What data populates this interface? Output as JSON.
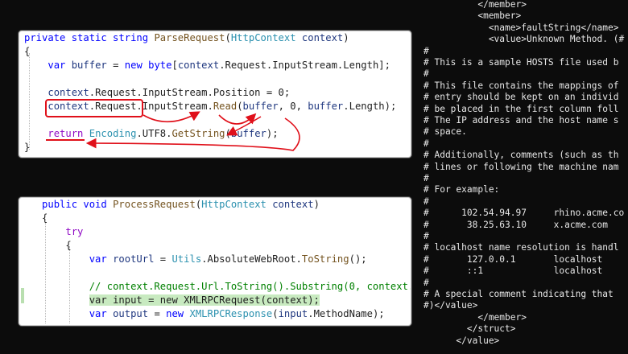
{
  "snippet_top": {
    "lines": [
      [
        {
          "c": "kw",
          "t": "private static string "
        },
        {
          "c": "mt",
          "t": "ParseRequest"
        },
        {
          "c": "",
          "t": "("
        },
        {
          "c": "ty",
          "t": "HttpContext"
        },
        {
          "c": "vr",
          "t": " context"
        },
        {
          "c": "",
          "t": ")"
        }
      ],
      [
        {
          "c": "",
          "t": "{"
        }
      ],
      [
        {
          "c": "",
          "t": "    "
        },
        {
          "c": "kw",
          "t": "var "
        },
        {
          "c": "vr",
          "t": "buffer"
        },
        {
          "c": "",
          "t": " = "
        },
        {
          "c": "kw",
          "t": "new byte"
        },
        {
          "c": "",
          "t": "["
        },
        {
          "c": "vr",
          "t": "context"
        },
        {
          "c": "",
          "t": ".Request.InputStream.Length];"
        }
      ],
      [
        {
          "c": "",
          "t": ""
        }
      ],
      [
        {
          "c": "",
          "t": "    "
        },
        {
          "c": "vr",
          "t": "context"
        },
        {
          "c": "",
          "t": ".Request.InputStream.Position = 0;"
        }
      ],
      [
        {
          "c": "",
          "t": "    "
        },
        {
          "c": "vr",
          "t": "context"
        },
        {
          "c": "",
          "t": ".Request.InputStream."
        },
        {
          "c": "mt",
          "t": "Read"
        },
        {
          "c": "",
          "t": "("
        },
        {
          "c": "vr",
          "t": "buffer"
        },
        {
          "c": "",
          "t": ", 0, "
        },
        {
          "c": "vr",
          "t": "buffer"
        },
        {
          "c": "",
          "t": ".Length);"
        }
      ],
      [
        {
          "c": "",
          "t": ""
        }
      ],
      [
        {
          "c": "",
          "t": "    "
        },
        {
          "c": "ctl",
          "t": "return "
        },
        {
          "c": "ty",
          "t": "Encoding"
        },
        {
          "c": "",
          "t": ".UTF8."
        },
        {
          "c": "mt",
          "t": "GetString"
        },
        {
          "c": "",
          "t": "("
        },
        {
          "c": "vr",
          "t": "buffer"
        },
        {
          "c": "",
          "t": ");"
        }
      ],
      [
        {
          "c": "",
          "t": "}"
        }
      ]
    ]
  },
  "snippet_bottom": {
    "lines": [
      [
        {
          "c": "",
          "t": "   "
        },
        {
          "c": "kw",
          "t": "public void "
        },
        {
          "c": "mt",
          "t": "ProcessRequest"
        },
        {
          "c": "",
          "t": "("
        },
        {
          "c": "ty",
          "t": "HttpContext"
        },
        {
          "c": "vr",
          "t": " context"
        },
        {
          "c": "",
          "t": ")"
        }
      ],
      [
        {
          "c": "",
          "t": "   {"
        }
      ],
      [
        {
          "c": "",
          "t": "       "
        },
        {
          "c": "ctl",
          "t": "try"
        }
      ],
      [
        {
          "c": "",
          "t": "       {"
        }
      ],
      [
        {
          "c": "",
          "t": "           "
        },
        {
          "c": "kw",
          "t": "var "
        },
        {
          "c": "vr",
          "t": "rootUrl"
        },
        {
          "c": "",
          "t": " = "
        },
        {
          "c": "ty",
          "t": "Utils"
        },
        {
          "c": "",
          "t": ".AbsoluteWebRoot."
        },
        {
          "c": "mt",
          "t": "ToString"
        },
        {
          "c": "",
          "t": "();"
        }
      ],
      [
        {
          "c": "",
          "t": ""
        }
      ],
      [
        {
          "c": "",
          "t": "           "
        },
        {
          "c": "cm",
          "t": "// context.Request.Url.ToString().Substring(0, context."
        }
      ],
      [
        {
          "c": "",
          "t": "           "
        },
        {
          "c": "hl",
          "t": "var input = new XMLRPCRequest(context);"
        }
      ],
      [
        {
          "c": "",
          "t": "           "
        },
        {
          "c": "kw",
          "t": "var "
        },
        {
          "c": "vr",
          "t": "output"
        },
        {
          "c": "",
          "t": " = "
        },
        {
          "c": "kw",
          "t": "new "
        },
        {
          "c": "ty",
          "t": "XMLRPCResponse"
        },
        {
          "c": "",
          "t": "("
        },
        {
          "c": "vr",
          "t": "input"
        },
        {
          "c": "",
          "t": ".MethodName);"
        }
      ]
    ]
  },
  "terminal": {
    "lines": [
      "          </member>",
      "          <member>",
      "            <name>faultString</name>",
      "            <value>Unknown Method. (#",
      "#",
      "# This is a sample HOSTS file used b",
      "#",
      "# This file contains the mappings of",
      "# entry should be kept on an individ",
      "# be placed in the first column foll",
      "# The IP address and the host name s",
      "# space.",
      "#",
      "# Additionally, comments (such as th",
      "# lines or following the machine nam",
      "#",
      "# For example:",
      "#",
      "#      102.54.94.97     rhino.acme.co",
      "#       38.25.63.10     x.acme.com",
      "#",
      "# localhost name resolution is handl",
      "#       127.0.0.1       localhost",
      "#       ::1             localhost",
      "#",
      "# A special comment indicating that",
      "#)</value>",
      "          </member>",
      "        </struct>",
      "      </value>"
    ]
  },
  "colors": {
    "annotation_red": "#e0101a",
    "keyword": "#0000ff",
    "type": "#2b91af",
    "method": "#74531f",
    "variable": "#1f377f",
    "highlight": "#c8eac0",
    "terminal_bg": "#0c0c0c"
  }
}
